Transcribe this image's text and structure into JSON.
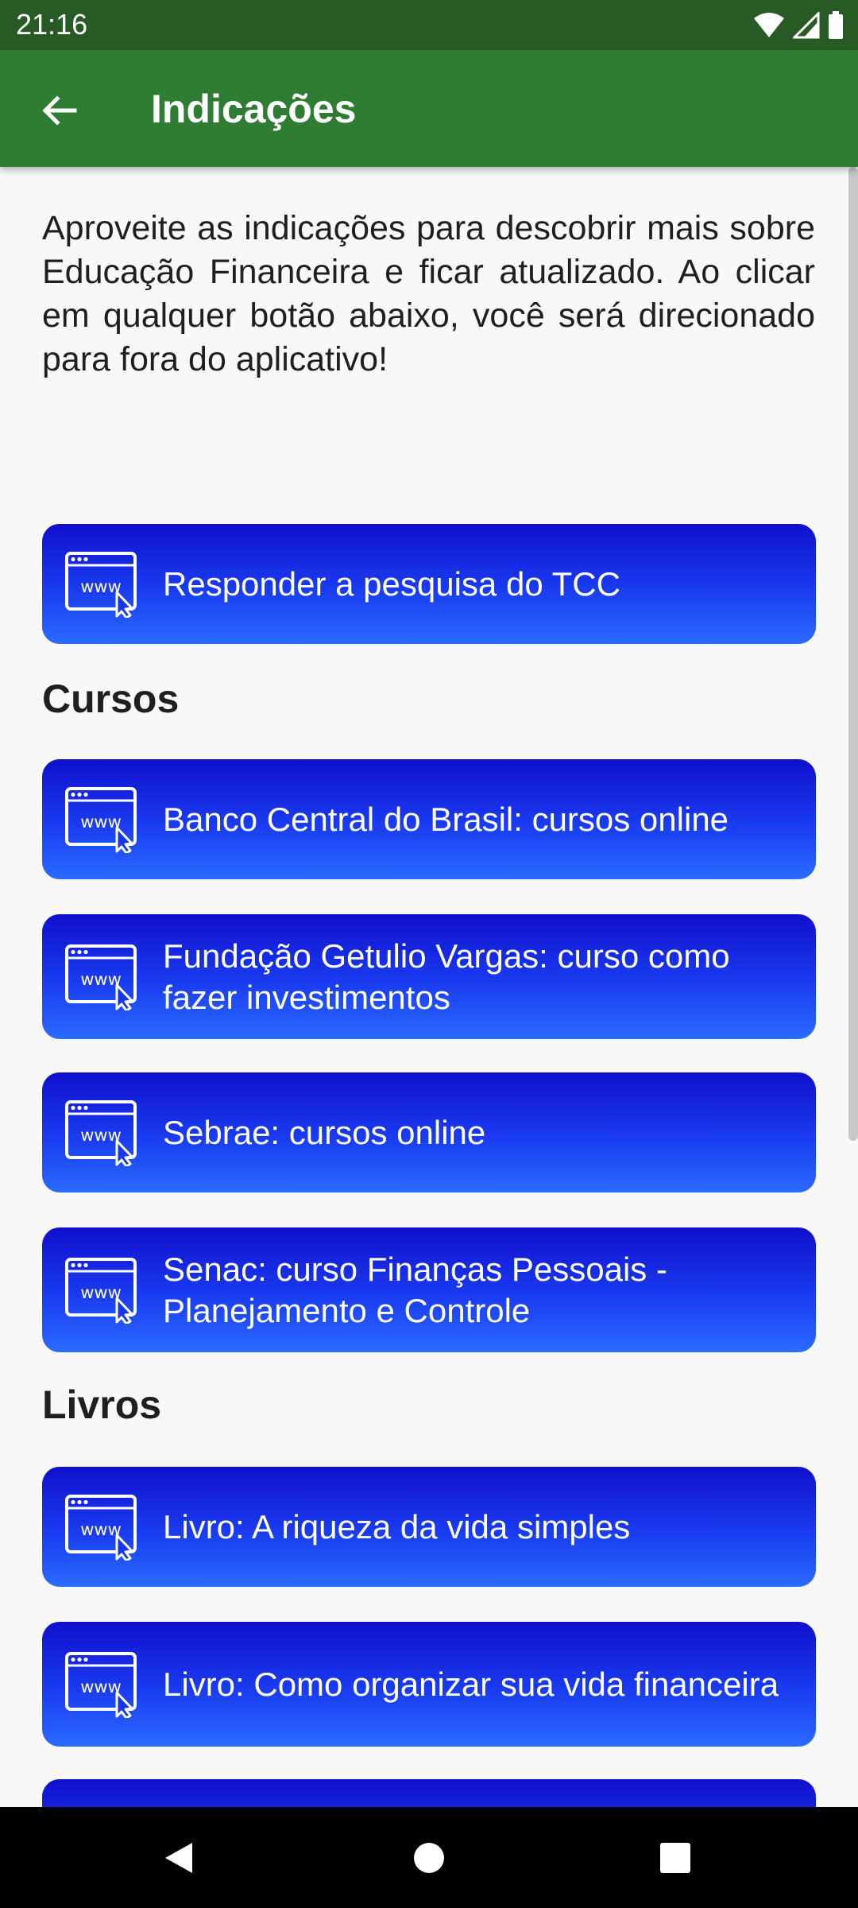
{
  "status_bar": {
    "time": "21:16"
  },
  "app_bar": {
    "title": "Indicações"
  },
  "intro_text": "Aproveite as indicações para descobrir mais sobre Educação Financeira e ficar atualizado. Ao clicar em qualquer botão abaixo, você será direcionado para fora do aplicativo!",
  "survey_button": {
    "label": "Responder a pesquisa do TCC",
    "icon": "www-icon"
  },
  "sections": {
    "courses": {
      "title": "Cursos",
      "items": [
        {
          "label": "Banco Central do Brasil: cursos online"
        },
        {
          "label": "Fundação Getulio Vargas: curso como fazer investimentos"
        },
        {
          "label": "Sebrae: cursos online"
        },
        {
          "label": "Senac: curso Finanças Pessoais - Planejamento e Controle"
        }
      ]
    },
    "books": {
      "title": "Livros",
      "items": [
        {
          "label": "Livro: A riqueza da vida simples"
        },
        {
          "label": "Livro: Como organizar sua vida financeira"
        }
      ]
    }
  },
  "colors": {
    "status_bar": "#275a24",
    "app_bar": "#2f7d32",
    "button_top": "#1010cc",
    "button_bottom": "#2a6bff",
    "background": "#f8f8f8"
  }
}
